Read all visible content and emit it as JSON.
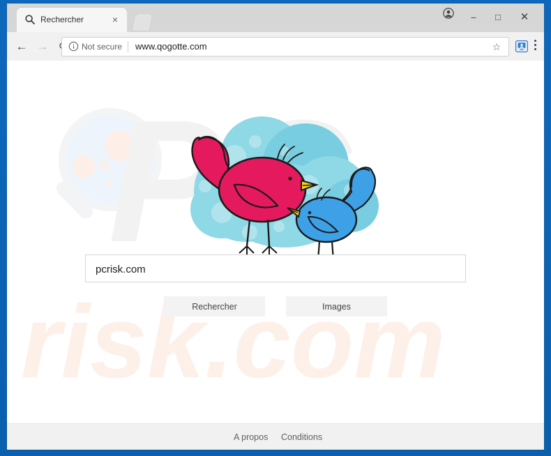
{
  "browser": {
    "tab": {
      "title": "Rechercher",
      "favicon": "search-icon",
      "close_label": "×"
    },
    "newtab_label": "",
    "window_controls": {
      "profile": "●",
      "minimize": "–",
      "maximize": "□",
      "close": "✕"
    },
    "toolbar": {
      "back": "←",
      "forward": "→",
      "reload": "⟳",
      "security_label": "Not secure",
      "url": "www.qogotte.com",
      "bookmark": "☆",
      "extension_icon": "cast-monitor-icon",
      "menu": "kebab-menu-icon"
    }
  },
  "page": {
    "logo_alt": "two-birds-cloud-logo",
    "search": {
      "value": "pcrisk.com",
      "placeholder": ""
    },
    "buttons": {
      "search": "Rechercher",
      "images": "Images"
    },
    "footer": {
      "about": "A propos",
      "terms": "Conditions"
    },
    "watermark": {
      "top": "PC",
      "bottom": "risk.com"
    }
  },
  "colors": {
    "window_border": "#0a62b6",
    "tabstrip": "#d6d6d6",
    "toolbar": "#f1f1f1",
    "bird_pink": "#e5195e",
    "bird_blue": "#2e9be0",
    "cloud": "#86d5e4",
    "beak_yellow": "#f5d211",
    "button_bg": "#f3f3f3",
    "footer_bg": "#f1f1f1"
  }
}
